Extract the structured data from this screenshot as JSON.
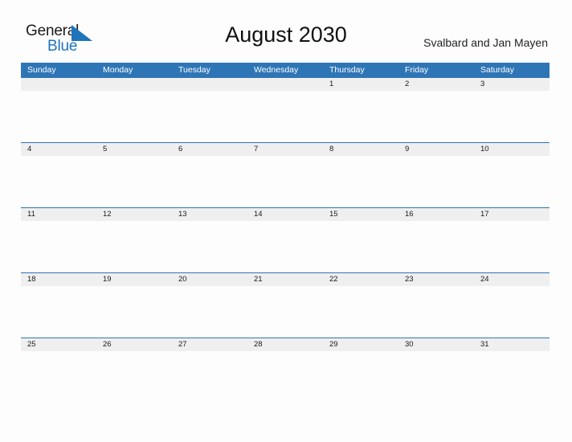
{
  "brand": {
    "logo_line1": "General",
    "logo_line2": "Blue",
    "triangle_icon": "triangle-icon",
    "logo_text_color": "#1a1a1a",
    "logo_accent_color": "#1f74bb"
  },
  "header": {
    "title": "August 2030",
    "region": "Svalbard and Jan Mayen"
  },
  "theme": {
    "header_blue": "#2e75b6",
    "date_band_gray": "#efefef",
    "page_background": "#fdfdfd",
    "text_dark": "#1a1a1a"
  },
  "calendar": {
    "weekdays": [
      "Sunday",
      "Monday",
      "Tuesday",
      "Wednesday",
      "Thursday",
      "Friday",
      "Saturday"
    ],
    "weeks": [
      {
        "days": [
          "",
          "",
          "",
          "",
          "1",
          "2",
          "3"
        ]
      },
      {
        "days": [
          "4",
          "5",
          "6",
          "7",
          "8",
          "9",
          "10"
        ]
      },
      {
        "days": [
          "11",
          "12",
          "13",
          "14",
          "15",
          "16",
          "17"
        ]
      },
      {
        "days": [
          "18",
          "19",
          "20",
          "21",
          "22",
          "23",
          "24"
        ]
      },
      {
        "days": [
          "25",
          "26",
          "27",
          "28",
          "29",
          "30",
          "31"
        ]
      }
    ]
  }
}
